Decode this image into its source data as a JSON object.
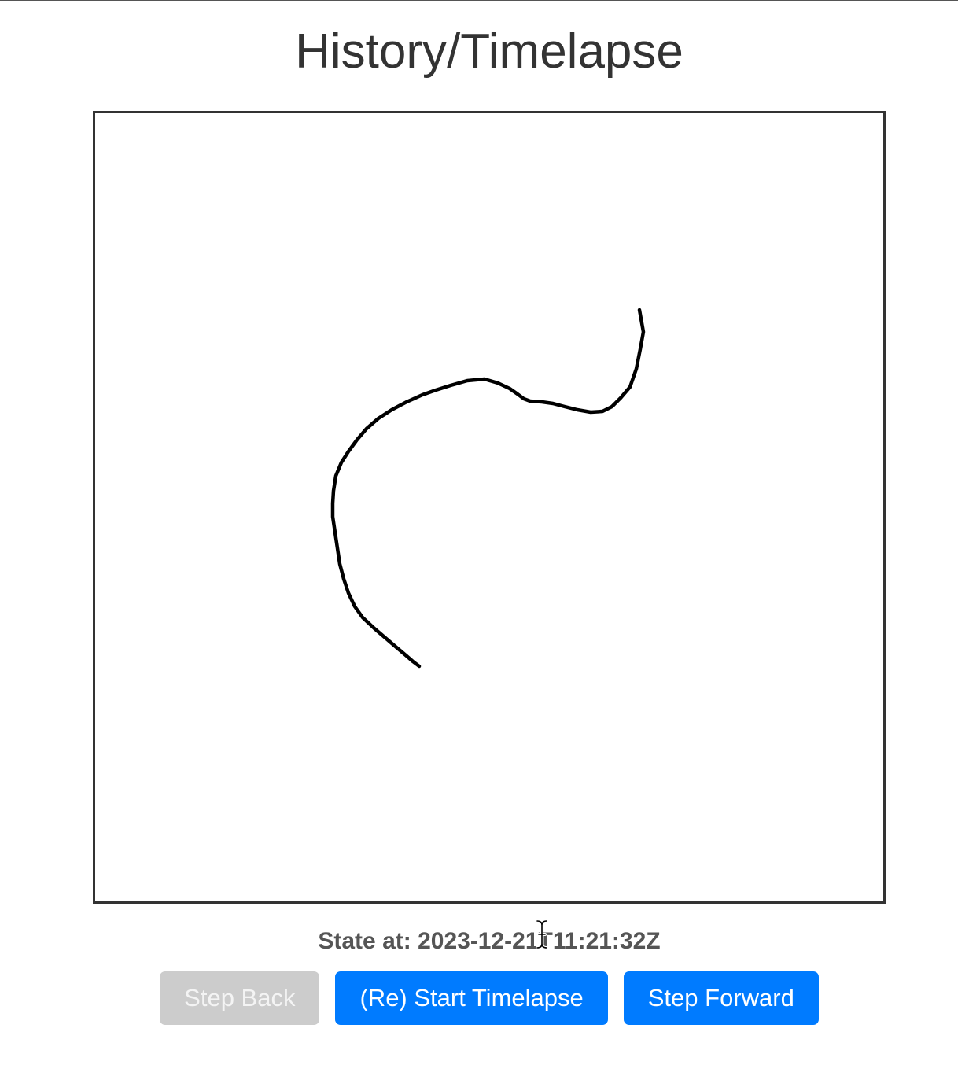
{
  "page": {
    "title": "History/Timelapse"
  },
  "state": {
    "label": "State at:",
    "timestamp": "2023-12-21T11:21:32Z"
  },
  "buttons": {
    "step_back": "Step Back",
    "restart": "(Re) Start Timelapse",
    "step_forward": "Step Forward"
  },
  "colors": {
    "primary": "#007bff",
    "disabled": "#cccccc",
    "stroke": "#000000"
  },
  "icons": {
    "cursor": "text-cursor-icon"
  }
}
